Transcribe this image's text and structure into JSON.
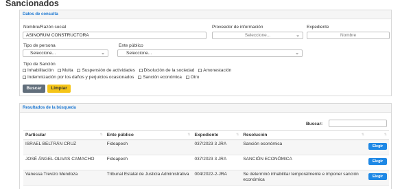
{
  "page": {
    "title": "Sancionados"
  },
  "search_panel": {
    "header": "Datos de consulta",
    "nombre": {
      "label": "Nombre/Razón social",
      "value": "ASINORUM CONSTRUCTORA"
    },
    "proveedor": {
      "label": "Proveedor de información",
      "value": "Seleccione..."
    },
    "expediente": {
      "label": "Expediente",
      "placeholder": "Nombre"
    },
    "tipo_persona": {
      "label": "Tipo de persona",
      "value": "Seleccione..."
    },
    "ente_publico": {
      "label": "Ente público",
      "value": "Seleccione..."
    },
    "tipo_sancion": {
      "label": "Tipo de Sanción",
      "options_row1": [
        "Inhabilitación",
        "Multa",
        "Suspensión de actividades",
        "Disolución de la sociedad",
        "Amonestación"
      ],
      "options_row2": [
        "Indemnización por los daños y perjuicios ocasionados",
        "Sanción económica",
        "Otro"
      ]
    },
    "buttons": {
      "search": "Buscar",
      "clear": "Limpiar"
    }
  },
  "results_panel": {
    "header": "Resultados de la búsqueda",
    "search_label": "Buscar:",
    "columns": [
      "Particular",
      "Ente público",
      "Expediente",
      "Resolución",
      ""
    ],
    "rows": [
      {
        "particular": "ISRAEL BELTRÁN CRUZ",
        "ente": "Fideapech",
        "expediente": "037/2023 3 JRA",
        "resolucion": "Sanción económica",
        "action": "Elegir"
      },
      {
        "particular": "JOSÉ ÁNGEL OLIVAS CAMACHO",
        "ente": "Fideapech",
        "expediente": "037/2023 3 JRA",
        "resolucion": "SANCIÓN ECONÓMICA",
        "action": "Elegir"
      },
      {
        "particular": "Vanessa Trevizo Mendoza",
        "ente": "Tribunal Estatal de Justicia Administrativa",
        "expediente": "004/2022-2-JRA",
        "resolucion": "Se determinó inhabilitar temporalmente e imponer sanción económica",
        "action": "Elegir"
      }
    ]
  },
  "colors": {
    "accent_blue": "#1976d2",
    "button_gray": "#616e7b",
    "button_yellow": "#f5c518",
    "edit_blue": "#1e88e5"
  },
  "icons": {
    "select_chevron": "chevron-down-icon",
    "sort": "sort-arrows-icon"
  }
}
